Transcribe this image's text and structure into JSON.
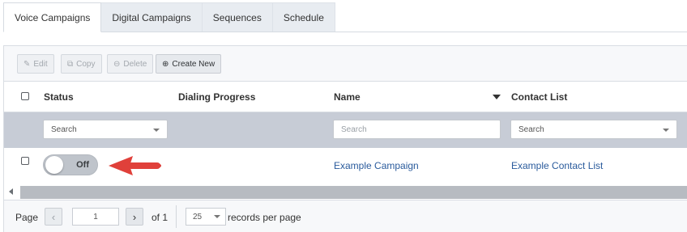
{
  "tabs": [
    {
      "label": "Voice Campaigns",
      "active": true
    },
    {
      "label": "Digital Campaigns",
      "active": false
    },
    {
      "label": "Sequences",
      "active": false
    },
    {
      "label": "Schedule",
      "active": false
    }
  ],
  "toolbar": {
    "edit_label": "Edit",
    "copy_label": "Copy",
    "delete_label": "Delete",
    "create_label": "Create New"
  },
  "columns": {
    "status": "Status",
    "dialing_progress": "Dialing Progress",
    "name": "Name",
    "contact_list": "Contact List"
  },
  "filters": {
    "status_value": "Search",
    "name_placeholder": "Search",
    "contact_list_value": "Search"
  },
  "rows": [
    {
      "status": "Off",
      "name": "Example Campaign",
      "contact_list": "Example Contact List"
    }
  ],
  "pager": {
    "page_label": "Page",
    "current_page": "1",
    "of_label": "of 1",
    "page_size": "25",
    "records_label": "records per page"
  },
  "colors": {
    "link": "#2a5b9c",
    "arrow": "#e0403a",
    "filter_bg": "#c7ccd6"
  },
  "icons": {
    "edit": "edit-icon",
    "copy": "copy-icon",
    "delete": "delete-icon",
    "create": "plus-circle-icon",
    "sort": "sort-desc-icon",
    "annotation": "red-arrow-icon"
  }
}
